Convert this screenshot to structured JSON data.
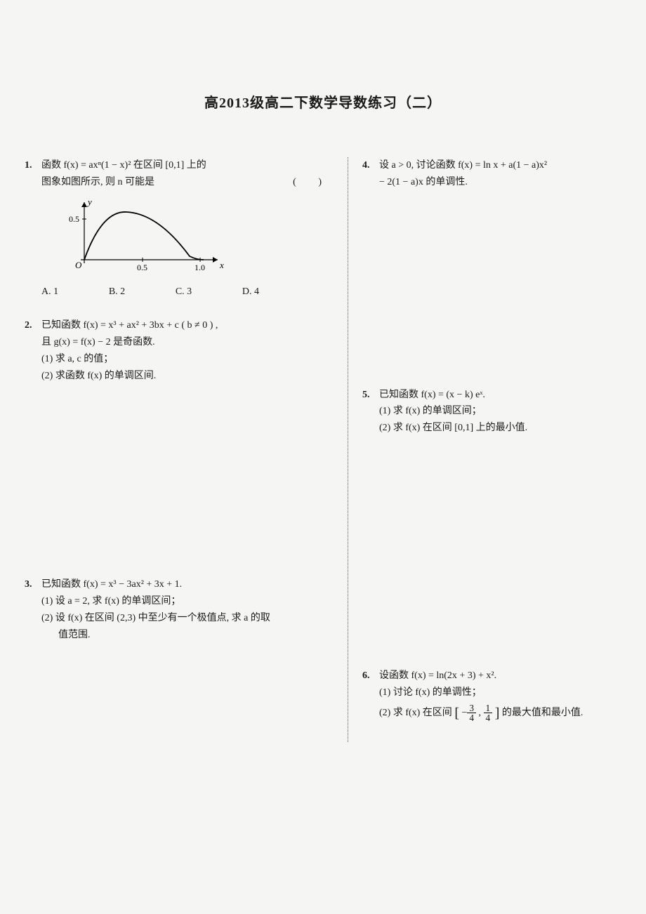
{
  "title": "高2013级高二下数学导数练习（二）",
  "problems": {
    "p1": {
      "num": "1.",
      "line1": "函数 f(x) = axⁿ(1 − x)² 在区间 [0,1] 上的",
      "line2": "图象如图所示, 则 n 可能是",
      "paren": "(      )",
      "choiceA": "A.  1",
      "choiceB": "B.  2",
      "choiceC": "C.  3",
      "choiceD": "D.  4",
      "graph": {
        "yTick": "0.5",
        "xTick1": "0.5",
        "xTick2": "1.0",
        "xLabel": "x",
        "yLabel": "y",
        "origin": "O"
      }
    },
    "p2": {
      "num": "2.",
      "line1": "已知函数 f(x) = x³ + ax² + 3bx + c ( b ≠ 0 ) ,",
      "line2": "且 g(x) = f(x) − 2 是奇函数.",
      "sub1": "(1) 求 a, c 的值；",
      "sub2": "(2) 求函数 f(x) 的单调区间."
    },
    "p3": {
      "num": "3.",
      "line1": "已知函数 f(x) = x³ − 3ax² + 3x + 1.",
      "sub1": "(1) 设 a = 2, 求 f(x) 的单调区间；",
      "sub2": "(2) 设 f(x) 在区间 (2,3) 中至少有一个极值点, 求 a 的取",
      "sub2b": "值范围."
    },
    "p4": {
      "num": "4.",
      "line1": "设 a > 0, 讨论函数 f(x) = ln x + a(1 − a)x²",
      "line2": "− 2(1 − a)x 的单调性."
    },
    "p5": {
      "num": "5.",
      "line1": "已知函数 f(x) = (x − k) eˣ.",
      "sub1": "(1) 求 f(x) 的单调区间；",
      "sub2": "(2) 求 f(x) 在区间 [0,1] 上的最小值."
    },
    "p6": {
      "num": "6.",
      "line1": "设函数 f(x) = ln(2x + 3) + x².",
      "sub1": "(1) 讨论 f(x) 的单调性；",
      "sub2a": "(2) 求 f(x) 在区间",
      "sub2b": "的最大值和最小值.",
      "frac1num": "3",
      "frac1den": "4",
      "frac2num": "1",
      "frac2den": "4"
    }
  }
}
